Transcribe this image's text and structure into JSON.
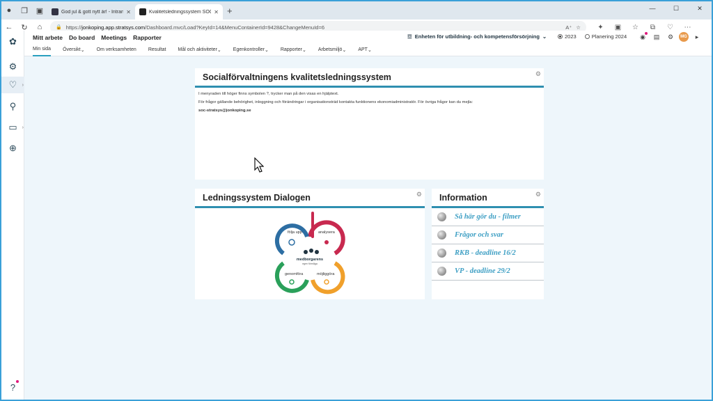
{
  "browser": {
    "tabs": [
      {
        "title": "God jul & gott nytt år! - Intranät"
      },
      {
        "title": "Kvalitetsledningssystem SOC - St"
      }
    ],
    "url_prefix": "https://",
    "url_domain": "jonkoping.app.stratsys.com",
    "url_path": "/Dashboard.mvc/Load?KeyId=14&MenuContainerId=9428&ChangeMenuId=6"
  },
  "appnav": {
    "items": [
      "Mitt arbete",
      "Do board",
      "Meetings",
      "Rapporter"
    ],
    "org": "Enheten för utbildning- och kompetensförsörjning",
    "year_current": "2023",
    "year_plan": "Planering 2024",
    "avatar": "MG"
  },
  "subnav": {
    "items": [
      "Min sida",
      "Översikt",
      "Om verksamheten",
      "Resultat",
      "Mål och aktiviteter",
      "Egenkontroller",
      "Rapporter",
      "Arbetsmiljö",
      "APT"
    ]
  },
  "panels": {
    "main": {
      "title": "Socialförvaltningens kvalitetsledningssystem",
      "line1": "I menyraden till höger finns symbolen ?, trycker man på den visas en hjälptext.",
      "line2": "För frågor gällande behörighet,  inloggning och förändringar i organisationsträd kontakta funktionens ekonomiadministratör. För övriga frågor kan du mejla:",
      "email": "soc-stratsys@jonkoping.se"
    },
    "dialog": {
      "title": "Ledningssystem Dialogen",
      "diagram": {
        "follow": "följa upp",
        "analyze": "analysera",
        "perform": "genomföra",
        "enable": "möjliggöra",
        "center": "medborgarens",
        "center_sub": "egen förmåga"
      }
    },
    "info": {
      "title": "Information",
      "links": [
        "Så här gör du - filmer",
        "Frågor och svar",
        "RKB - deadline 16/2",
        "VP - deadline 29/2"
      ]
    }
  },
  "colors": {
    "accent": "#2f8fb0",
    "link": "#3e9fc4",
    "blue": "#2d6ea3",
    "red": "#c8294f",
    "green": "#2aa05a",
    "orange": "#f0a02b"
  }
}
